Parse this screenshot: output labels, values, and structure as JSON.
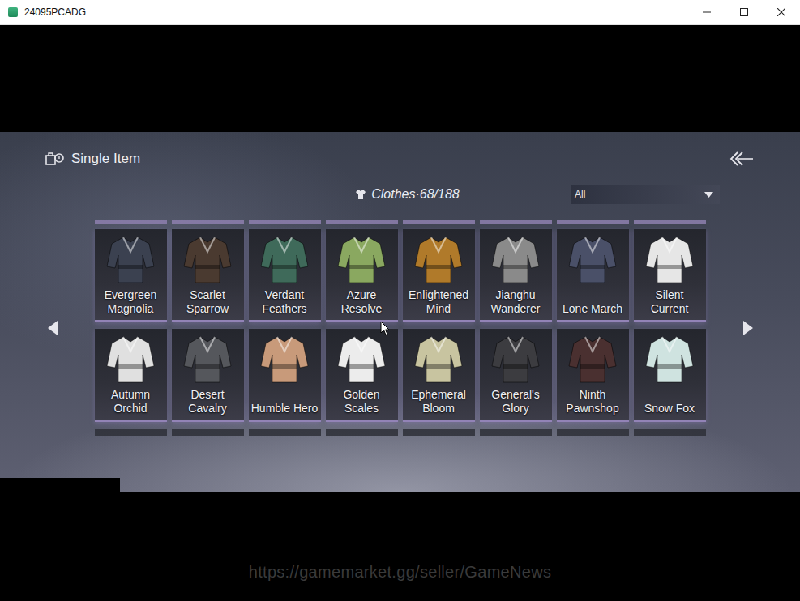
{
  "window": {
    "title": "24095PCADG"
  },
  "header": {
    "title": "Single Item"
  },
  "counter": {
    "label": "Clothes",
    "separator": "·",
    "count": "68/188"
  },
  "filter": {
    "value": "All"
  },
  "items": [
    {
      "name": "Evergreen Magnolia",
      "color": "#3b4150"
    },
    {
      "name": "Scarlet Sparrow",
      "color": "#4a3a30"
    },
    {
      "name": "Verdant Feathers",
      "color": "#3f6a5a"
    },
    {
      "name": "Azure Resolve",
      "color": "#8aa860"
    },
    {
      "name": "Enlightened Mind",
      "color": "#b07a2a"
    },
    {
      "name": "Jianghu Wanderer",
      "color": "#8a8a8a"
    },
    {
      "name": "Lone March",
      "color": "#4a5068"
    },
    {
      "name": "Silent Current",
      "color": "#e6e6e6"
    },
    {
      "name": "Autumn Orchid",
      "color": "#e0e0e0"
    },
    {
      "name": "Desert Cavalry",
      "color": "#55575c"
    },
    {
      "name": "Humble Hero",
      "color": "#c89a7a"
    },
    {
      "name": "Golden Scales",
      "color": "#ececec"
    },
    {
      "name": "Ephemeral Bloom",
      "color": "#c8c4a0"
    },
    {
      "name": "General's Glory",
      "color": "#3c3c40"
    },
    {
      "name": "Ninth Pawnshop",
      "color": "#4a3030"
    },
    {
      "name": "Snow Fox",
      "color": "#cfe3e0"
    }
  ],
  "watermark": "https://gamemarket.gg/seller/GameNews"
}
